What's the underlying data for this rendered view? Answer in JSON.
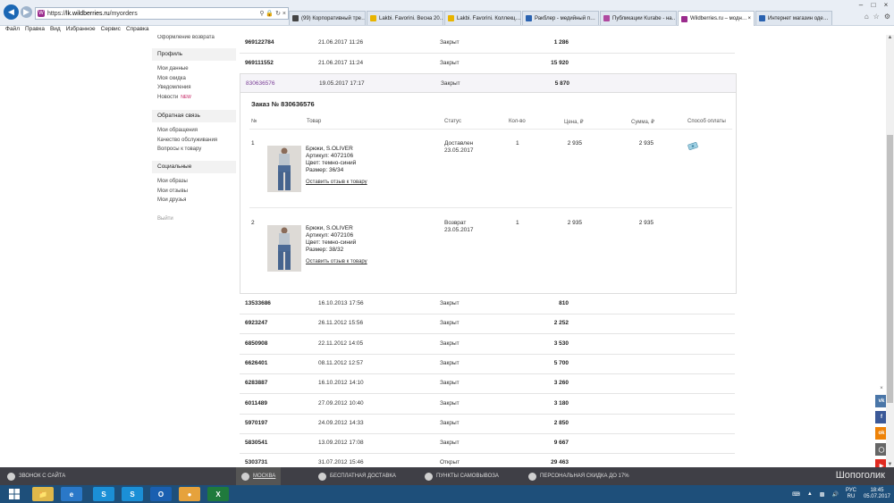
{
  "browser": {
    "url_host": "lk.wildberries.ru",
    "url_path": "/myorders",
    "url_prefix": "https://",
    "tabs": [
      {
        "title": "(99) Корпоративный тре…",
        "color": "#444444"
      },
      {
        "title": "Lakbi. Favorini. Весна 20…",
        "color": "#e8b400"
      },
      {
        "title": "Lakbi. Favorini. Коллекц…",
        "color": "#e8b400"
      },
      {
        "title": "Ракблер - медийный п…",
        "color": "#2a62b0"
      },
      {
        "title": "Публикации Kurabe - на…",
        "color": "#b04aa0"
      },
      {
        "title": "Wildberries.ru – модн…",
        "color": "#9b2c8d"
      },
      {
        "title": "Интернет магазин оде…",
        "color": "#2a62b0"
      }
    ],
    "menu": [
      "Файл",
      "Правка",
      "Вид",
      "Избранное",
      "Сервис",
      "Справка"
    ]
  },
  "sidebar": {
    "top_item": "Оформление возврата",
    "sections": [
      {
        "heading": "Профиль",
        "items": [
          "Мои данные",
          "Моя скидка",
          "Уведомления",
          "Новости"
        ]
      },
      {
        "heading": "Обратная связь",
        "items": [
          "Мои обращения",
          "Качество обслуживания",
          "Вопросы к товару"
        ]
      },
      {
        "heading": "Социальные",
        "items": [
          "Мои образы",
          "Мои отзывы",
          "Мои друзья"
        ]
      }
    ],
    "new_badge": "NEW",
    "logout": "Выйти"
  },
  "orders_top": [
    {
      "id": "969122784",
      "date": "21.06.2017 11:26",
      "status": "Закрыт",
      "sum": "1 286"
    },
    {
      "id": "969111552",
      "date": "21.06.2017 11:24",
      "status": "Закрыт",
      "sum": "15 920"
    }
  ],
  "open_order": {
    "id": "830636576",
    "date": "19.05.2017 17:17",
    "status": "Закрыт",
    "sum": "5 870"
  },
  "detail": {
    "title": "Заказ № 830636576",
    "headers": {
      "num": "№",
      "product": "Товар",
      "status": "Статус",
      "qty": "Кол-во",
      "price": "Цена, ₽",
      "sum": "Сумма, ₽",
      "pay": "Способ оплаты"
    },
    "items": [
      {
        "num": "1",
        "name": "Брюки, S.OLIVER",
        "article": "Артикул:  4072106",
        "color": "Цвет:  темно-синий",
        "size": "Размер:  36/34",
        "review": "Оставить отзыв к товару",
        "status": "Доставлен",
        "status_date": "23.05.2017",
        "qty": "1",
        "price": "2 935",
        "sum": "2 935"
      },
      {
        "num": "2",
        "name": "Брюки, S.OLIVER",
        "article": "Артикул:  4072106",
        "color": "Цвет:  темно-синий",
        "size": "Размер:  38/32",
        "review": "Оставить отзыв к товару",
        "status": "Возврат",
        "status_date": "23.05.2017",
        "qty": "1",
        "price": "2 935",
        "sum": "2 935"
      }
    ]
  },
  "orders_bottom": [
    {
      "id": "13533686",
      "date": "16.10.2013 17:56",
      "status": "Закрыт",
      "sum": "810"
    },
    {
      "id": "6923247",
      "date": "26.11.2012 15:56",
      "status": "Закрыт",
      "sum": "2 252"
    },
    {
      "id": "6850908",
      "date": "22.11.2012 14:05",
      "status": "Закрыт",
      "sum": "3 530"
    },
    {
      "id": "6626401",
      "date": "08.11.2012 12:57",
      "status": "Закрыт",
      "sum": "5 700"
    },
    {
      "id": "6283887",
      "date": "16.10.2012 14:10",
      "status": "Закрыт",
      "sum": "3 260"
    },
    {
      "id": "6011489",
      "date": "27.09.2012 10:40",
      "status": "Закрыт",
      "sum": "3 180"
    },
    {
      "id": "5970197",
      "date": "24.09.2012 14:33",
      "status": "Закрыт",
      "sum": "2 850"
    },
    {
      "id": "5830541",
      "date": "13.09.2012 17:08",
      "status": "Закрыт",
      "sum": "9 667"
    },
    {
      "id": "5303731",
      "date": "31.07.2012 15:46",
      "status": "Открыт",
      "sum": "29 463"
    }
  ],
  "social": [
    {
      "label": "vk",
      "color": "#4a76a8"
    },
    {
      "label": "f",
      "color": "#3b5998"
    },
    {
      "label": "ok",
      "color": "#ee8208"
    },
    {
      "label": "ig",
      "color": "#666666"
    },
    {
      "label": "yt",
      "color": "#e02a20"
    }
  ],
  "site_bar": {
    "call": "ЗВОНОК С САЙТА",
    "city": "МОСКВА",
    "delivery": "БЕСПЛАТНАЯ ДОСТАВКА",
    "pickup": "ПУНКТЫ САМОВЫВОЗА",
    "discount": "ПЕРСОНАЛЬНАЯ СКИДКА ДО 17%",
    "watermark": "Шопоголик"
  },
  "taskbar": {
    "lang": "РУС",
    "lang_sub": "RU",
    "time": "18:45",
    "date": "05.07.2017"
  }
}
